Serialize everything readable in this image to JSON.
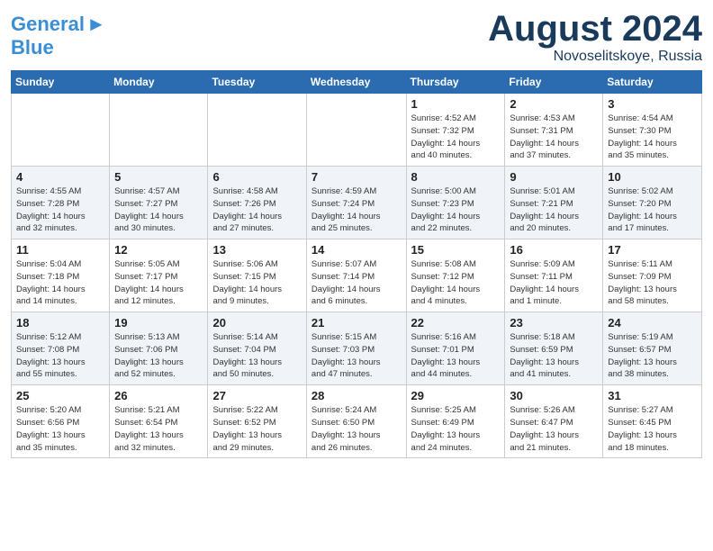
{
  "header": {
    "logo_line1": "General",
    "logo_line2": "Blue",
    "month_title": "August 2024",
    "location": "Novoselitskoye, Russia"
  },
  "calendar": {
    "days_of_week": [
      "Sunday",
      "Monday",
      "Tuesday",
      "Wednesday",
      "Thursday",
      "Friday",
      "Saturday"
    ],
    "weeks": [
      [
        {
          "day": "",
          "info": ""
        },
        {
          "day": "",
          "info": ""
        },
        {
          "day": "",
          "info": ""
        },
        {
          "day": "",
          "info": ""
        },
        {
          "day": "1",
          "info": "Sunrise: 4:52 AM\nSunset: 7:32 PM\nDaylight: 14 hours\nand 40 minutes."
        },
        {
          "day": "2",
          "info": "Sunrise: 4:53 AM\nSunset: 7:31 PM\nDaylight: 14 hours\nand 37 minutes."
        },
        {
          "day": "3",
          "info": "Sunrise: 4:54 AM\nSunset: 7:30 PM\nDaylight: 14 hours\nand 35 minutes."
        }
      ],
      [
        {
          "day": "4",
          "info": "Sunrise: 4:55 AM\nSunset: 7:28 PM\nDaylight: 14 hours\nand 32 minutes."
        },
        {
          "day": "5",
          "info": "Sunrise: 4:57 AM\nSunset: 7:27 PM\nDaylight: 14 hours\nand 30 minutes."
        },
        {
          "day": "6",
          "info": "Sunrise: 4:58 AM\nSunset: 7:26 PM\nDaylight: 14 hours\nand 27 minutes."
        },
        {
          "day": "7",
          "info": "Sunrise: 4:59 AM\nSunset: 7:24 PM\nDaylight: 14 hours\nand 25 minutes."
        },
        {
          "day": "8",
          "info": "Sunrise: 5:00 AM\nSunset: 7:23 PM\nDaylight: 14 hours\nand 22 minutes."
        },
        {
          "day": "9",
          "info": "Sunrise: 5:01 AM\nSunset: 7:21 PM\nDaylight: 14 hours\nand 20 minutes."
        },
        {
          "day": "10",
          "info": "Sunrise: 5:02 AM\nSunset: 7:20 PM\nDaylight: 14 hours\nand 17 minutes."
        }
      ],
      [
        {
          "day": "11",
          "info": "Sunrise: 5:04 AM\nSunset: 7:18 PM\nDaylight: 14 hours\nand 14 minutes."
        },
        {
          "day": "12",
          "info": "Sunrise: 5:05 AM\nSunset: 7:17 PM\nDaylight: 14 hours\nand 12 minutes."
        },
        {
          "day": "13",
          "info": "Sunrise: 5:06 AM\nSunset: 7:15 PM\nDaylight: 14 hours\nand 9 minutes."
        },
        {
          "day": "14",
          "info": "Sunrise: 5:07 AM\nSunset: 7:14 PM\nDaylight: 14 hours\nand 6 minutes."
        },
        {
          "day": "15",
          "info": "Sunrise: 5:08 AM\nSunset: 7:12 PM\nDaylight: 14 hours\nand 4 minutes."
        },
        {
          "day": "16",
          "info": "Sunrise: 5:09 AM\nSunset: 7:11 PM\nDaylight: 14 hours\nand 1 minute."
        },
        {
          "day": "17",
          "info": "Sunrise: 5:11 AM\nSunset: 7:09 PM\nDaylight: 13 hours\nand 58 minutes."
        }
      ],
      [
        {
          "day": "18",
          "info": "Sunrise: 5:12 AM\nSunset: 7:08 PM\nDaylight: 13 hours\nand 55 minutes."
        },
        {
          "day": "19",
          "info": "Sunrise: 5:13 AM\nSunset: 7:06 PM\nDaylight: 13 hours\nand 52 minutes."
        },
        {
          "day": "20",
          "info": "Sunrise: 5:14 AM\nSunset: 7:04 PM\nDaylight: 13 hours\nand 50 minutes."
        },
        {
          "day": "21",
          "info": "Sunrise: 5:15 AM\nSunset: 7:03 PM\nDaylight: 13 hours\nand 47 minutes."
        },
        {
          "day": "22",
          "info": "Sunrise: 5:16 AM\nSunset: 7:01 PM\nDaylight: 13 hours\nand 44 minutes."
        },
        {
          "day": "23",
          "info": "Sunrise: 5:18 AM\nSunset: 6:59 PM\nDaylight: 13 hours\nand 41 minutes."
        },
        {
          "day": "24",
          "info": "Sunrise: 5:19 AM\nSunset: 6:57 PM\nDaylight: 13 hours\nand 38 minutes."
        }
      ],
      [
        {
          "day": "25",
          "info": "Sunrise: 5:20 AM\nSunset: 6:56 PM\nDaylight: 13 hours\nand 35 minutes."
        },
        {
          "day": "26",
          "info": "Sunrise: 5:21 AM\nSunset: 6:54 PM\nDaylight: 13 hours\nand 32 minutes."
        },
        {
          "day": "27",
          "info": "Sunrise: 5:22 AM\nSunset: 6:52 PM\nDaylight: 13 hours\nand 29 minutes."
        },
        {
          "day": "28",
          "info": "Sunrise: 5:24 AM\nSunset: 6:50 PM\nDaylight: 13 hours\nand 26 minutes."
        },
        {
          "day": "29",
          "info": "Sunrise: 5:25 AM\nSunset: 6:49 PM\nDaylight: 13 hours\nand 24 minutes."
        },
        {
          "day": "30",
          "info": "Sunrise: 5:26 AM\nSunset: 6:47 PM\nDaylight: 13 hours\nand 21 minutes."
        },
        {
          "day": "31",
          "info": "Sunrise: 5:27 AM\nSunset: 6:45 PM\nDaylight: 13 hours\nand 18 minutes."
        }
      ]
    ]
  }
}
